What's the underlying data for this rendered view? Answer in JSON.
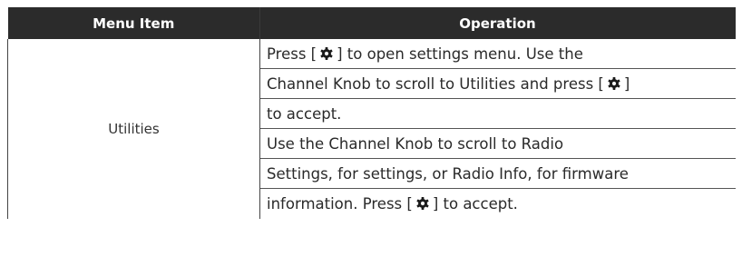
{
  "table": {
    "headers": {
      "menu_item": "Menu Item",
      "operation": "Operation"
    },
    "row": {
      "menu_item": "Utilities",
      "operation_lines": [
        {
          "before": "Press  [",
          "icon": "gear-icon",
          "after": "] to open settings menu. Use the"
        },
        {
          "before": "Channel Knob to scroll to Utilities and press [",
          "icon": "gear-icon",
          "after": "]"
        },
        {
          "before": "to accept.",
          "icon": null,
          "after": ""
        },
        {
          "before": "Use the Channel Knob to scroll to Radio",
          "icon": null,
          "after": ""
        },
        {
          "before": "Settings, for settings, or Radio Info, for firmware",
          "icon": null,
          "after": ""
        },
        {
          "before": "information. Press [",
          "icon": "gear-icon",
          "after": "] to accept."
        }
      ]
    }
  }
}
